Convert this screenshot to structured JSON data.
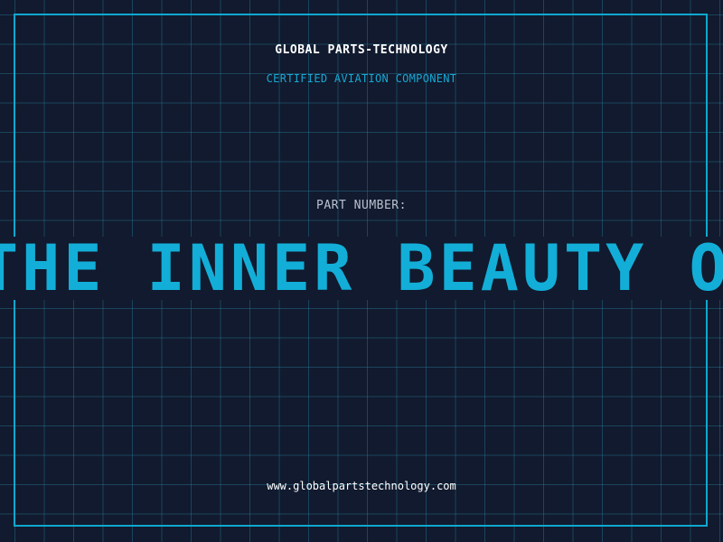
{
  "header": {
    "company": "GLOBAL PARTS-TECHNOLOGY",
    "tagline": "CERTIFIED AVIATION COMPONENT"
  },
  "part": {
    "label": "PART NUMBER:",
    "value": "THE INNER BEAUTY OF"
  },
  "footer": {
    "website": "www.globalpartstechnology.com"
  },
  "colors": {
    "background": "#111a2e",
    "accent": "#12aed8",
    "grid": "#28788f",
    "text_primary": "#ffffff",
    "text_muted": "#b9c2cf"
  }
}
